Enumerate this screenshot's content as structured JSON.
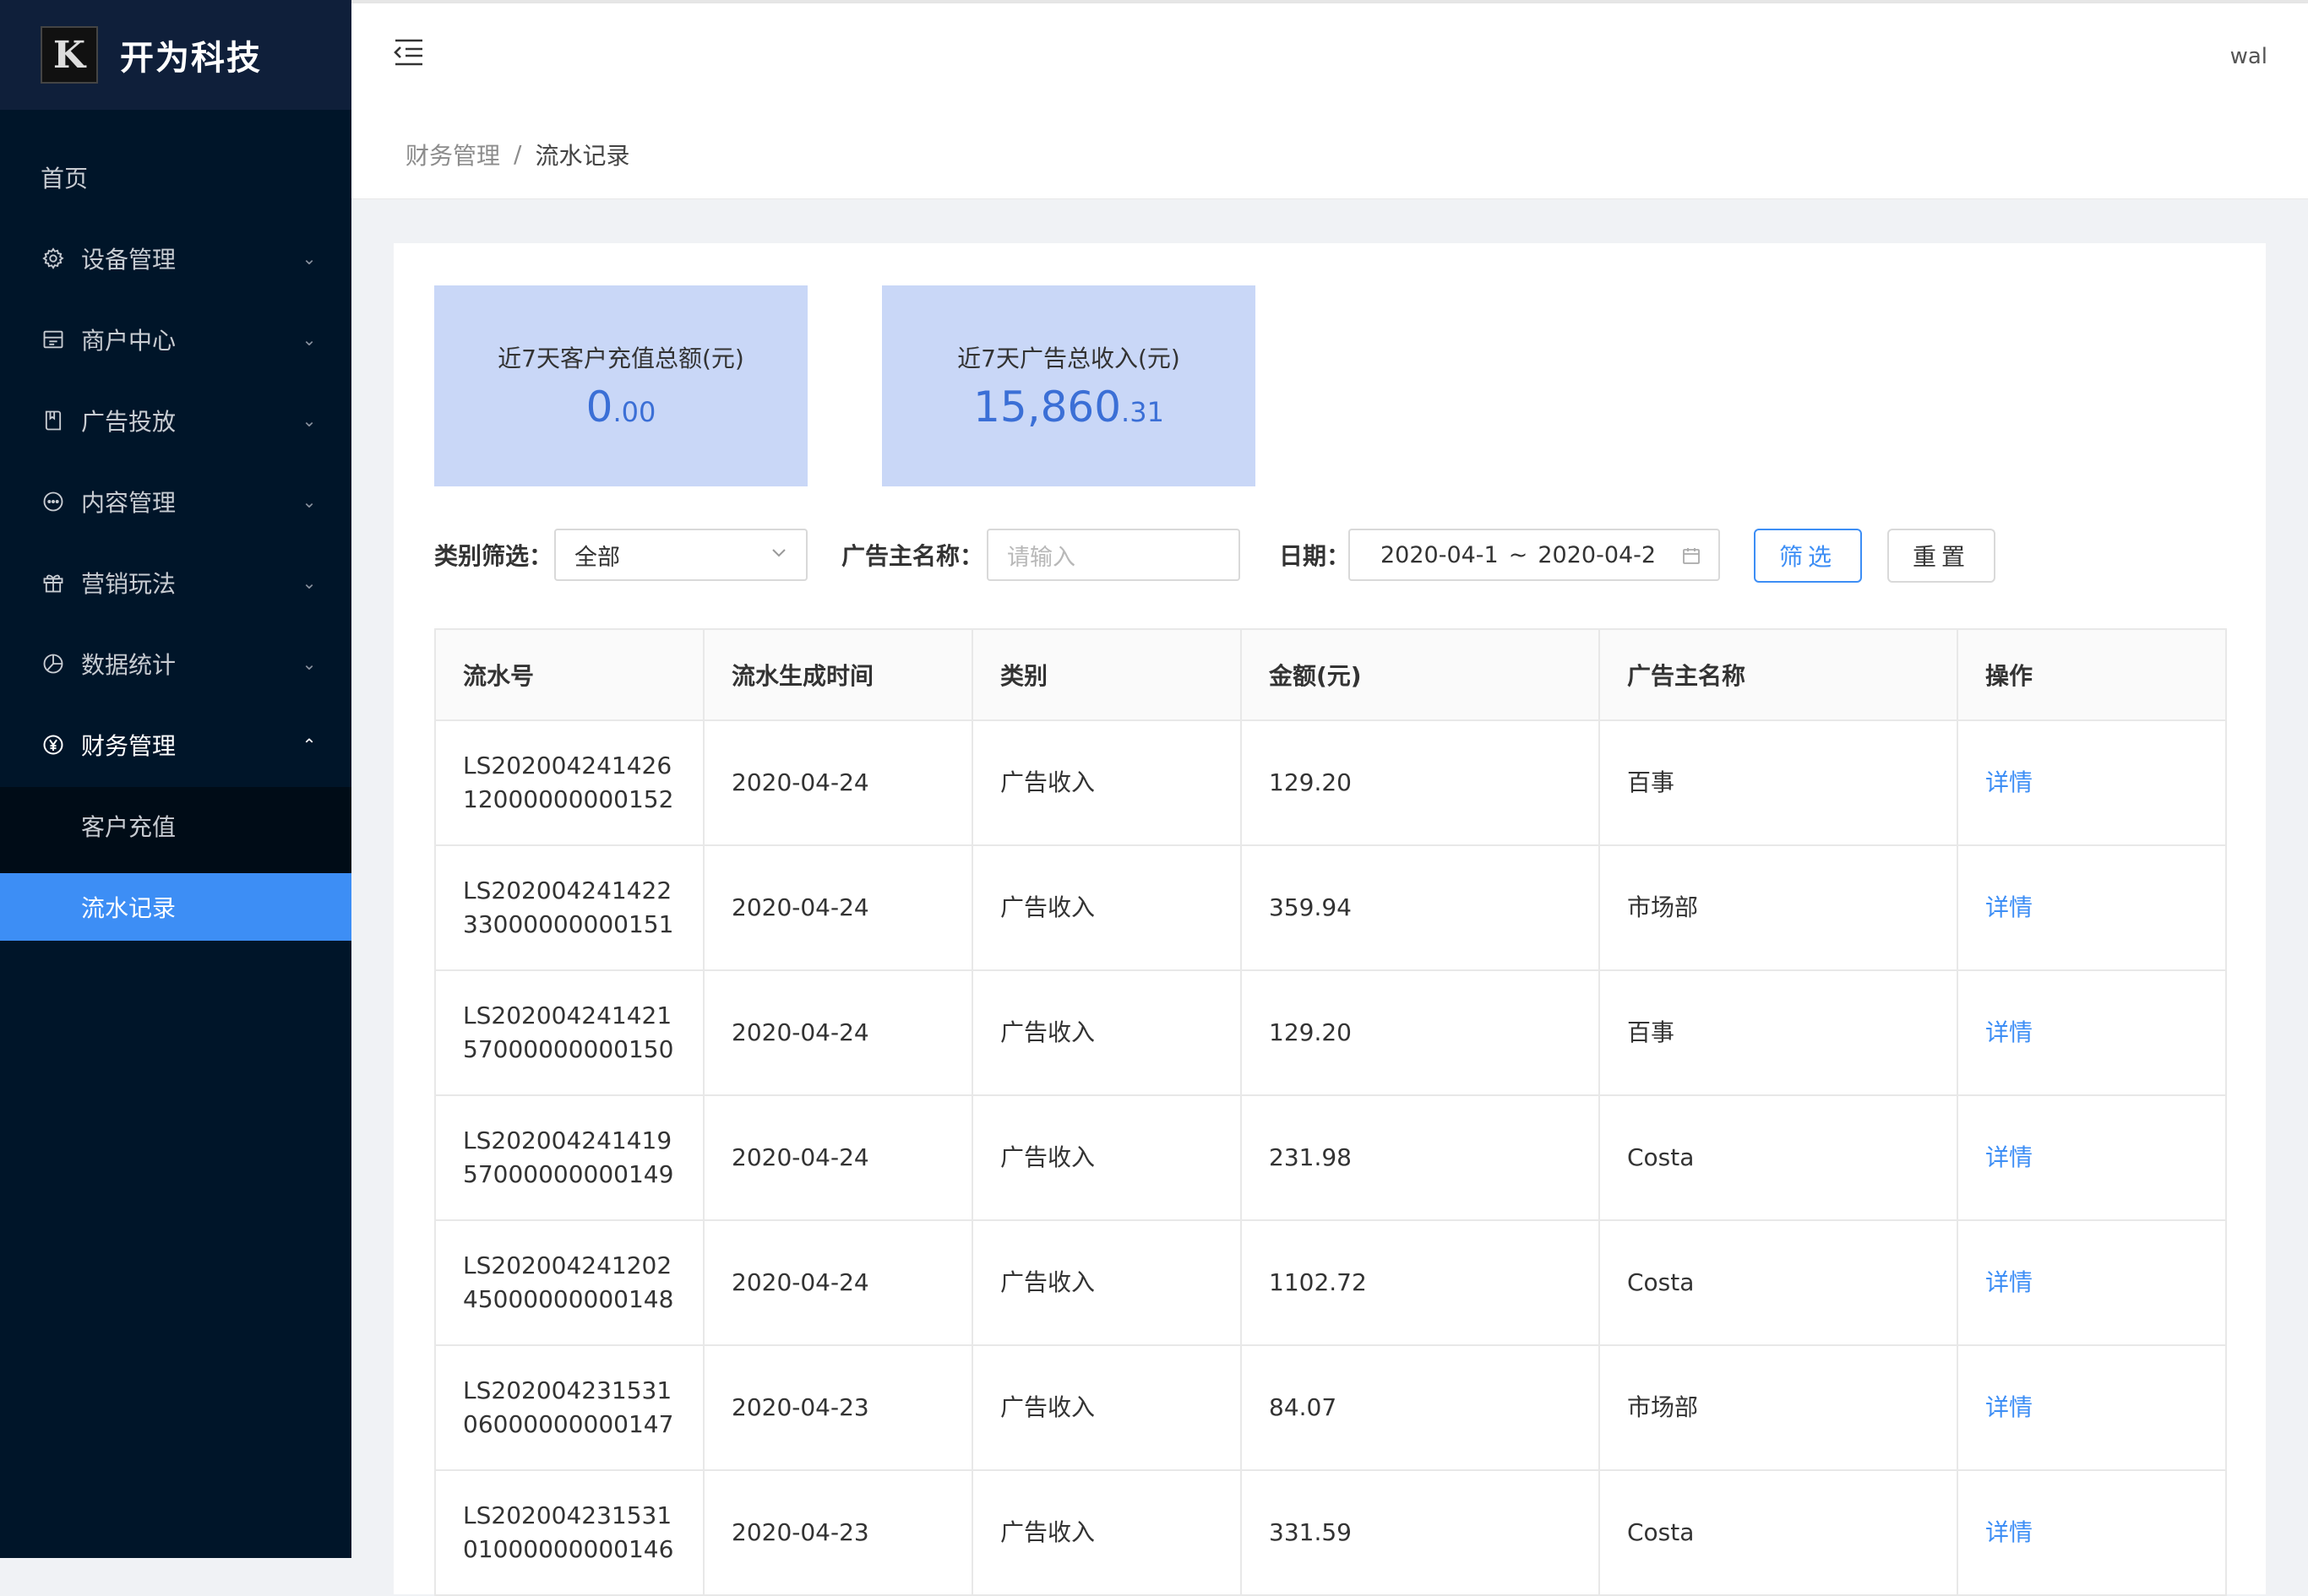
{
  "brand": {
    "name": "开为科技",
    "logo_letter": "K"
  },
  "user": {
    "name": "wal"
  },
  "sidebar": {
    "home": "首页",
    "items": [
      {
        "label": "设备管理",
        "icon": "gear-icon"
      },
      {
        "label": "商户中心",
        "icon": "store-icon"
      },
      {
        "label": "广告投放",
        "icon": "book-icon"
      },
      {
        "label": "内容管理",
        "icon": "chat-icon"
      },
      {
        "label": "营销玩法",
        "icon": "gift-icon"
      },
      {
        "label": "数据统计",
        "icon": "pie-chart-icon"
      },
      {
        "label": "财务管理",
        "icon": "yen-icon"
      }
    ],
    "sub_items": [
      {
        "label": "客户充值"
      },
      {
        "label": "流水记录"
      }
    ]
  },
  "breadcrumb": {
    "parent": "财务管理",
    "separator": "/",
    "current": "流水记录"
  },
  "stats": [
    {
      "title": "近7天客户充值总额(元)",
      "int": "0",
      "dec": ".00"
    },
    {
      "title": "近7天广告总收入(元)",
      "int": "15,860",
      "dec": ".31"
    }
  ],
  "filters": {
    "category_label": "类别筛选：",
    "category_value": "全部",
    "advertiser_label": "广告主名称：",
    "advertiser_placeholder": "请输入",
    "date_label": "日期：",
    "date_start": "2020-04-1",
    "date_sep": "~",
    "date_end": "2020-04-2",
    "filter_button": "筛选",
    "reset_button": "重置"
  },
  "table": {
    "headers": [
      "流水号",
      "流水生成时间",
      "类别",
      "金额(元)",
      "广告主名称",
      "操作"
    ],
    "rows": [
      {
        "id1": "LS202004241426",
        "id2": "12000000000152",
        "date": "2020-04-24",
        "type": "广告收入",
        "amount": "129.20",
        "advertiser": "百事",
        "action": "详情"
      },
      {
        "id1": "LS202004241422",
        "id2": "33000000000151",
        "date": "2020-04-24",
        "type": "广告收入",
        "amount": "359.94",
        "advertiser": "市场部",
        "action": "详情"
      },
      {
        "id1": "LS202004241421",
        "id2": "57000000000150",
        "date": "2020-04-24",
        "type": "广告收入",
        "amount": "129.20",
        "advertiser": "百事",
        "action": "详情"
      },
      {
        "id1": "LS202004241419",
        "id2": "57000000000149",
        "date": "2020-04-24",
        "type": "广告收入",
        "amount": "231.98",
        "advertiser": "Costa",
        "action": "详情"
      },
      {
        "id1": "LS202004241202",
        "id2": "45000000000148",
        "date": "2020-04-24",
        "type": "广告收入",
        "amount": "1102.72",
        "advertiser": "Costa",
        "action": "详情"
      },
      {
        "id1": "LS202004231531",
        "id2": "06000000000147",
        "date": "2020-04-23",
        "type": "广告收入",
        "amount": "84.07",
        "advertiser": "市场部",
        "action": "详情"
      },
      {
        "id1": "LS202004231531",
        "id2": "01000000000146",
        "date": "2020-04-23",
        "type": "广告收入",
        "amount": "331.59",
        "advertiser": "Costa",
        "action": "详情"
      }
    ]
  },
  "colors": {
    "sidebar_bg": "#001529",
    "accent": "#3d8ef5",
    "stat_bg": "#c9d7f7"
  }
}
